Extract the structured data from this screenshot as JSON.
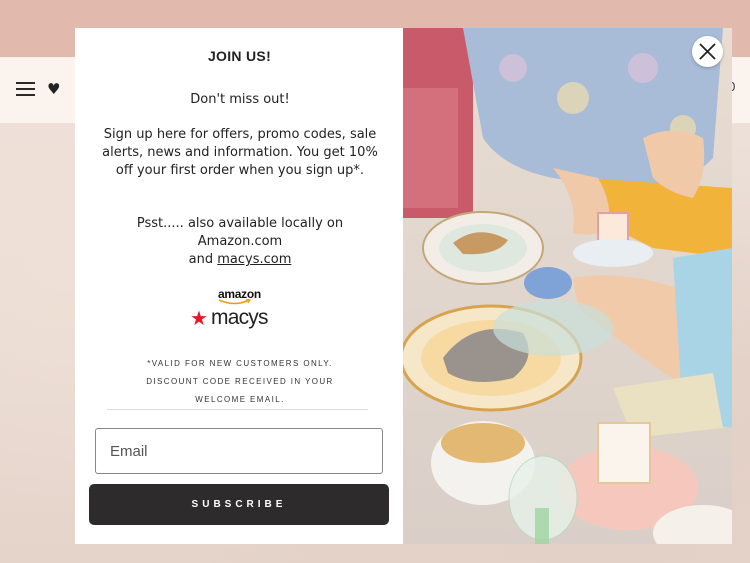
{
  "header": {
    "menu_icon": "hamburger-icon",
    "wishlist_icon": "heart-icon",
    "cart_count": "0"
  },
  "popup": {
    "title": "JOIN US!",
    "headline": "Don't miss out!",
    "body": "Sign up here for offers, promo codes, sale alerts, news and information. You get 10% off your first order when you sign up*.",
    "psst_text": "Psst..... also available locally on Amazon.com",
    "and_text": "and",
    "macys_link": "macys.com",
    "amazon_logo": "amazon",
    "macys_logo": "macys",
    "fine_print_1": "*VALID FOR NEW CUSTOMERS ONLY.",
    "fine_print_2": "DISCOUNT CODE RECEIVED IN YOUR",
    "fine_print_3": "WELCOME EMAIL.",
    "email_placeholder": "Email",
    "subscribe_label": "SUBSCRIBE",
    "close_icon": "close-icon"
  },
  "colors": {
    "topbar": "#e1b9ad",
    "header": "#fbf3ee",
    "button": "#2d2b2b",
    "macys_star": "#e11a2b"
  }
}
